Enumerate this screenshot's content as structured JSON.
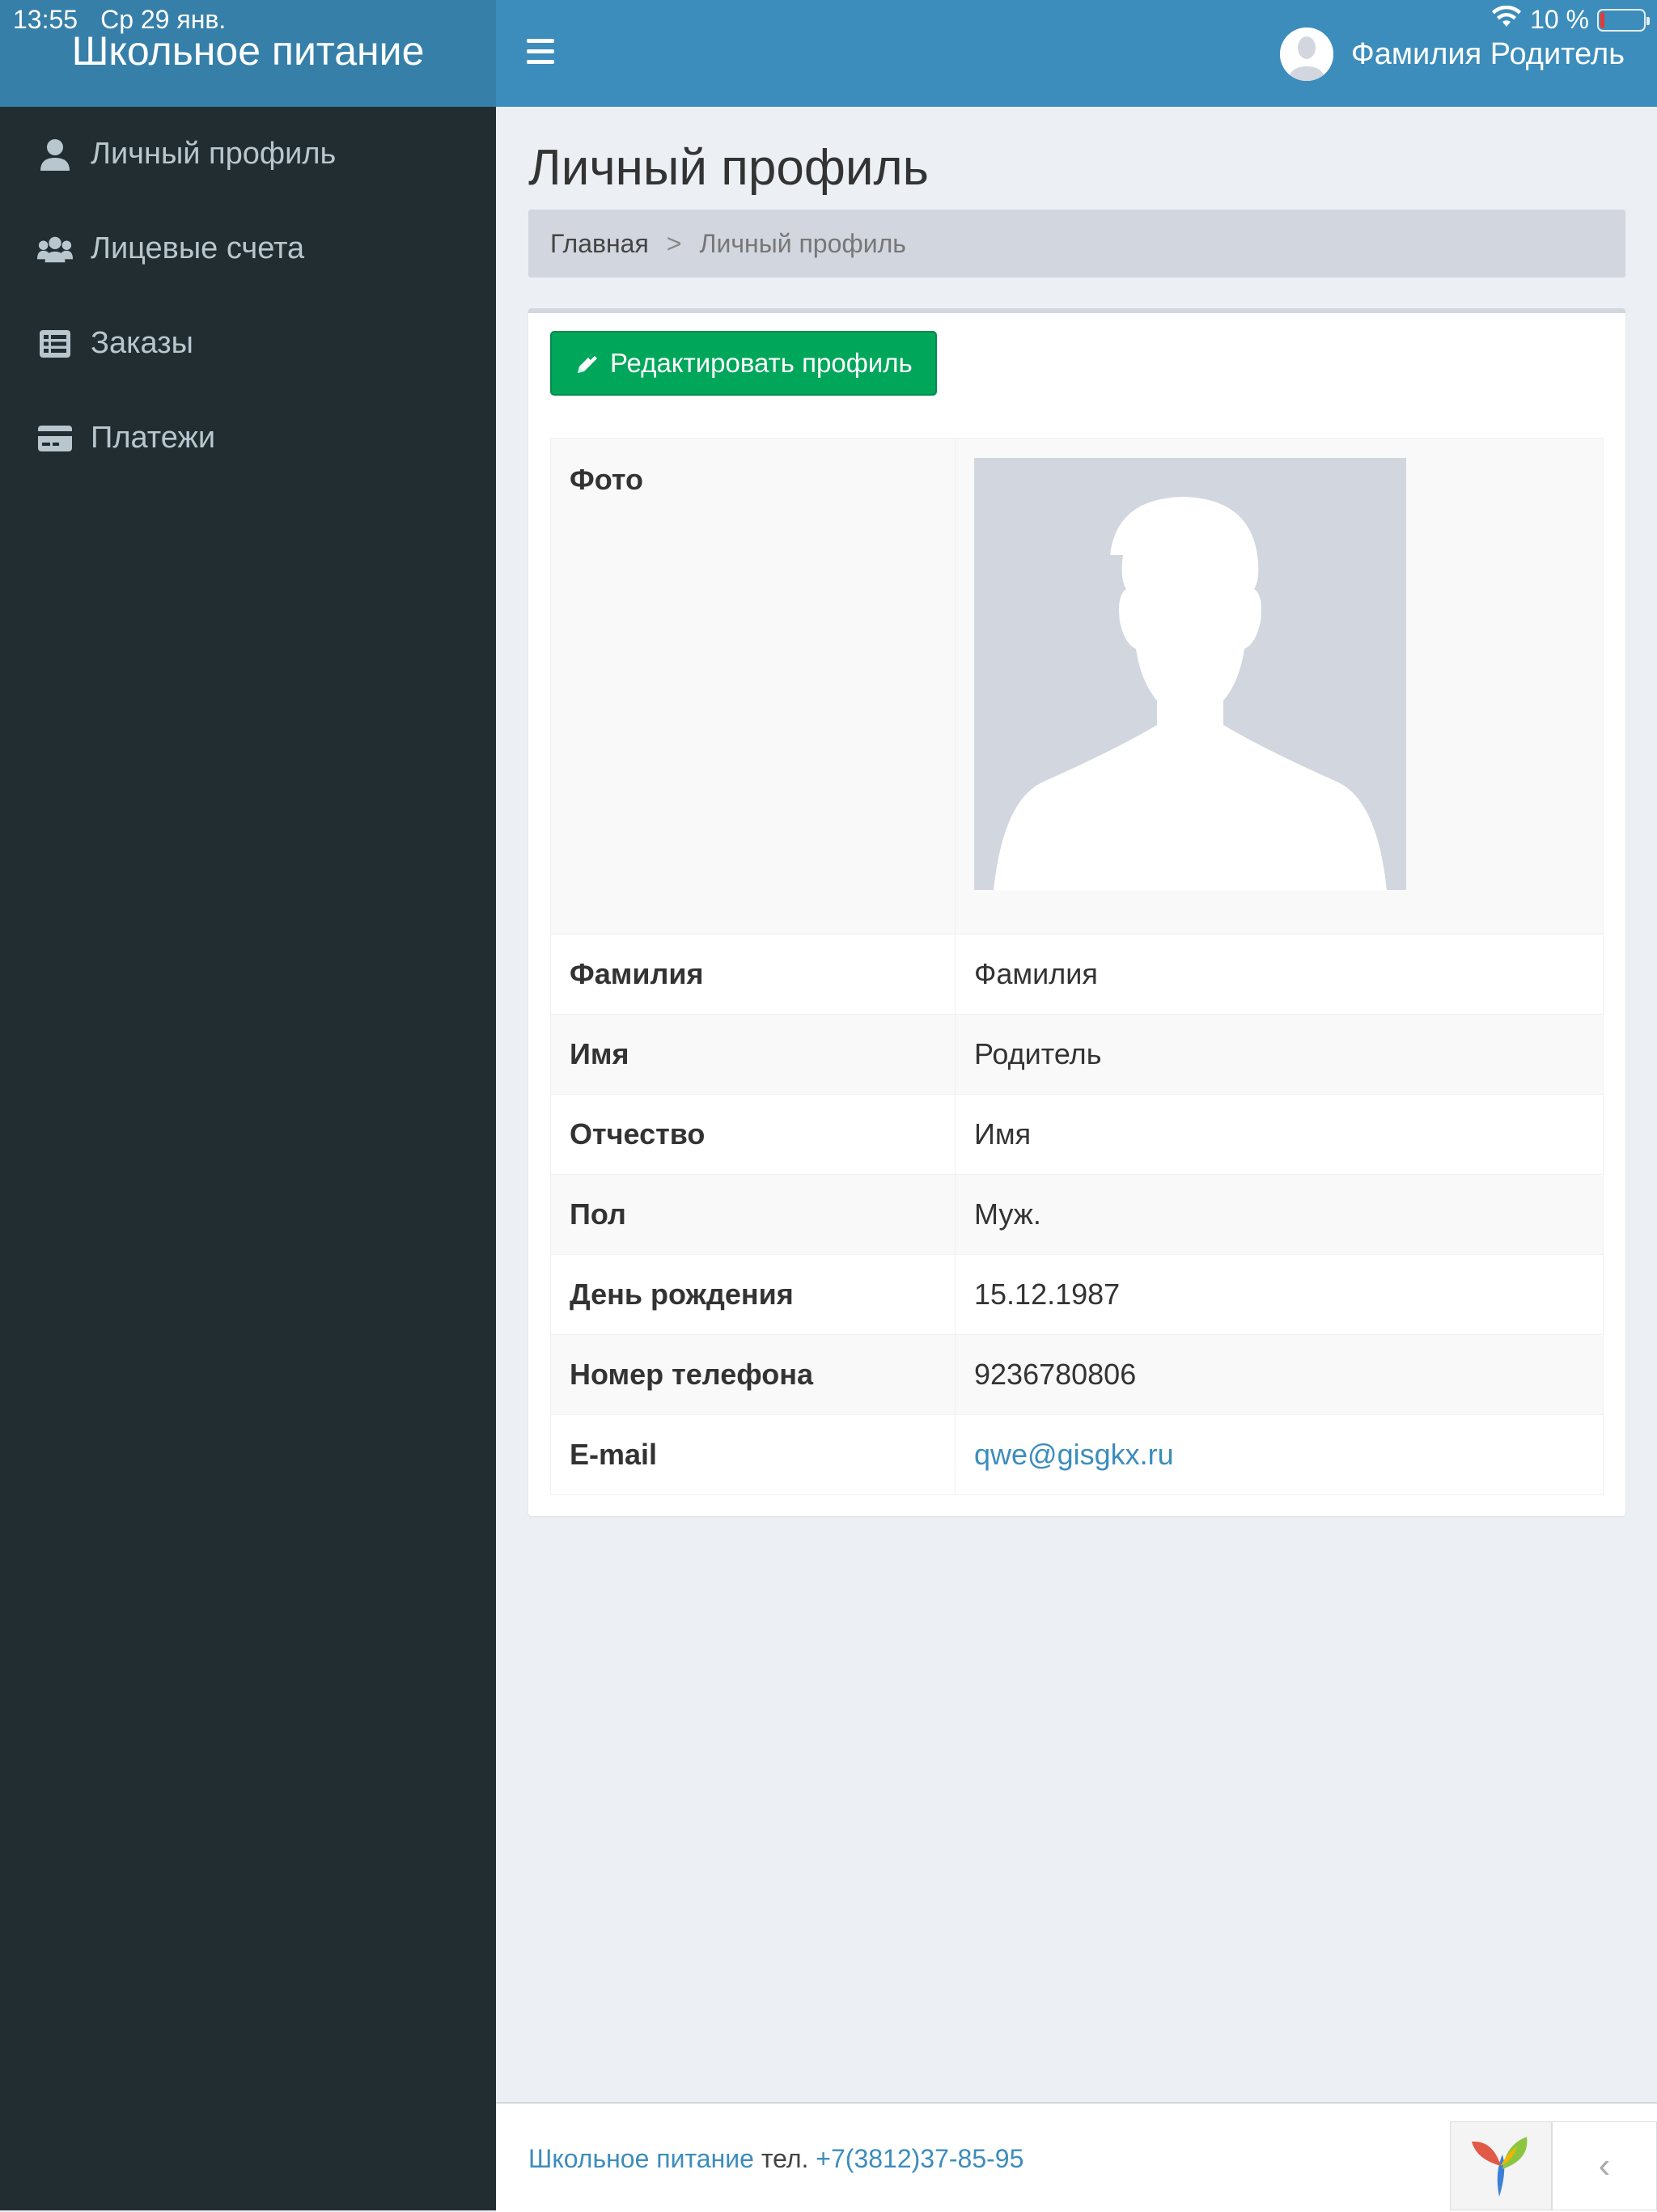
{
  "status_bar": {
    "time": "13:55",
    "date": "Ср 29 янв.",
    "battery_text": "10 %",
    "battery_level": 0.1,
    "wifi_icon": "wifi-icon"
  },
  "app": {
    "title": "Школьное питание"
  },
  "sidebar": {
    "items": [
      {
        "label": "Личный профиль",
        "icon": "user-icon"
      },
      {
        "label": "Лицевые счета",
        "icon": "users-icon"
      },
      {
        "label": "Заказы",
        "icon": "list-icon"
      },
      {
        "label": "Платежи",
        "icon": "credit-card-icon"
      }
    ]
  },
  "header": {
    "menu_icon": "hamburger-icon",
    "user_name": "Фамилия Родитель"
  },
  "page": {
    "title": "Личный профиль",
    "breadcrumb": {
      "home": "Главная",
      "separator": ">",
      "current": "Личный профиль"
    },
    "edit_button": "Редактировать профиль",
    "detail": {
      "photo_label": "Фото",
      "rows": [
        {
          "label": "Фамилия",
          "value": "Фамилия"
        },
        {
          "label": "Имя",
          "value": "Родитель"
        },
        {
          "label": "Отчество",
          "value": "Имя"
        },
        {
          "label": "Пол",
          "value": "Муж."
        },
        {
          "label": "День рождения",
          "value": "15.12.1987"
        },
        {
          "label": "Номер телефона",
          "value": "9236780806"
        },
        {
          "label": "E-mail",
          "value": "qwe@gisgkx.ru"
        }
      ]
    }
  },
  "footer": {
    "brand": "Школьное питание",
    "phone_label": "тел.",
    "phone": "+7(3812)37-85-95",
    "collapse_glyph": "‹"
  },
  "colors": {
    "header": "#3c8dbc",
    "logo": "#367fa9",
    "sidebar": "#222d32",
    "edit_button": "#00a65a",
    "link": "#3c8dbc"
  }
}
